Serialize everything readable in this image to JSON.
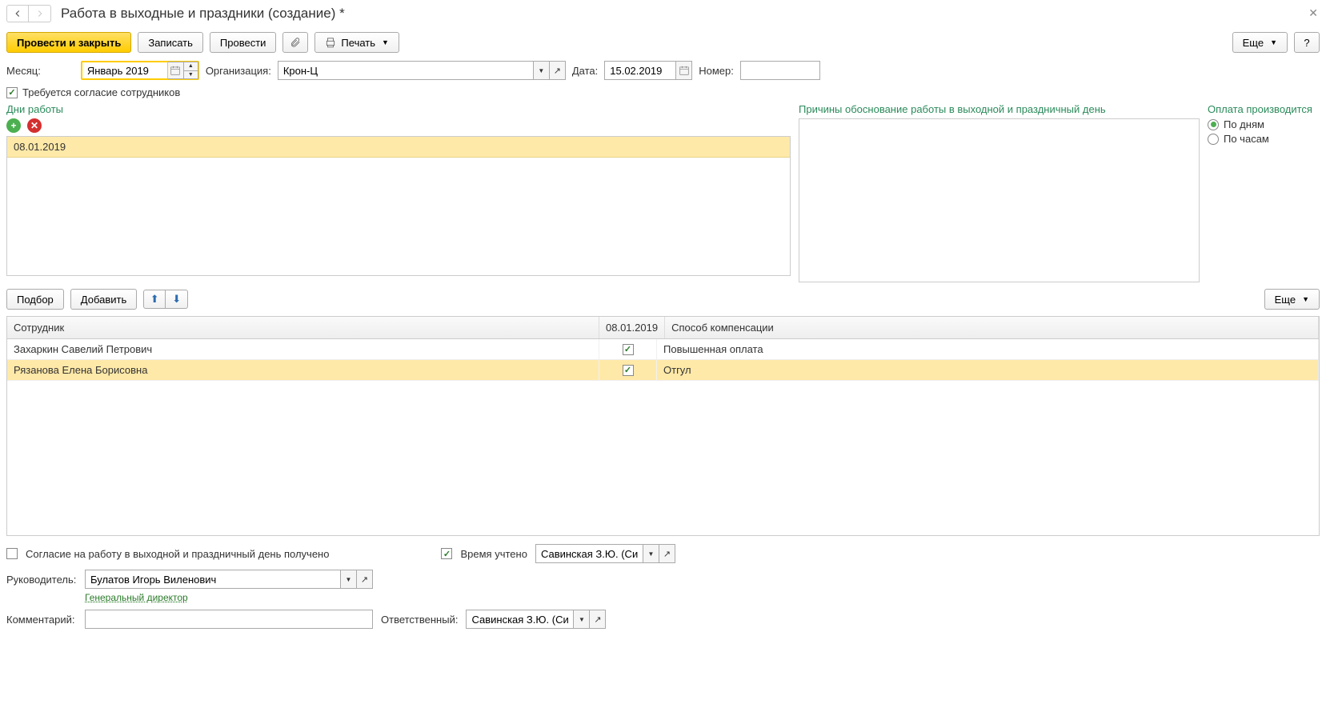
{
  "title": "Работа в выходные и праздники (создание) *",
  "toolbar": {
    "post_close": "Провести и закрыть",
    "save": "Записать",
    "post": "Провести",
    "print": "Печать",
    "more": "Еще",
    "help": "?"
  },
  "form": {
    "month_label": "Месяц:",
    "month_value": "Январь 2019",
    "org_label": "Организация:",
    "org_value": "Крон-Ц",
    "date_label": "Дата:",
    "date_value": "15.02.2019",
    "number_label": "Номер:",
    "number_value": ""
  },
  "consent_required_label": "Требуется согласие сотрудников",
  "days": {
    "title": "Дни работы",
    "items": [
      "08.01.2019"
    ]
  },
  "reasons": {
    "title": "Причины обоснование работы в выходной и праздничный день"
  },
  "payment": {
    "title": "Оплата производится",
    "by_days": "По дням",
    "by_hours": "По часам"
  },
  "emp_toolbar": {
    "select": "Подбор",
    "add": "Добавить",
    "more": "Еще"
  },
  "emp_table": {
    "col_employee": "Сотрудник",
    "col_date": "08.01.2019",
    "col_compensation": "Способ компенсации",
    "rows": [
      {
        "name": "Захаркин Савелий Петрович",
        "checked": true,
        "comp": "Повышенная оплата"
      },
      {
        "name": "Рязанова Елена Борисовна",
        "checked": true,
        "comp": "Отгул"
      }
    ]
  },
  "footer": {
    "consent_received": "Согласие на работу в выходной и праздничный день получено",
    "time_recorded": "Время учтено",
    "time_user": "Савинская З.Ю. (Системн",
    "manager_label": "Руководитель:",
    "manager_value": "Булатов Игорь Виленович",
    "manager_position": "Генеральный директор",
    "comment_label": "Комментарий:",
    "comment_value": "",
    "responsible_label": "Ответственный:",
    "responsible_value": "Савинская З.Ю. (Системн"
  }
}
